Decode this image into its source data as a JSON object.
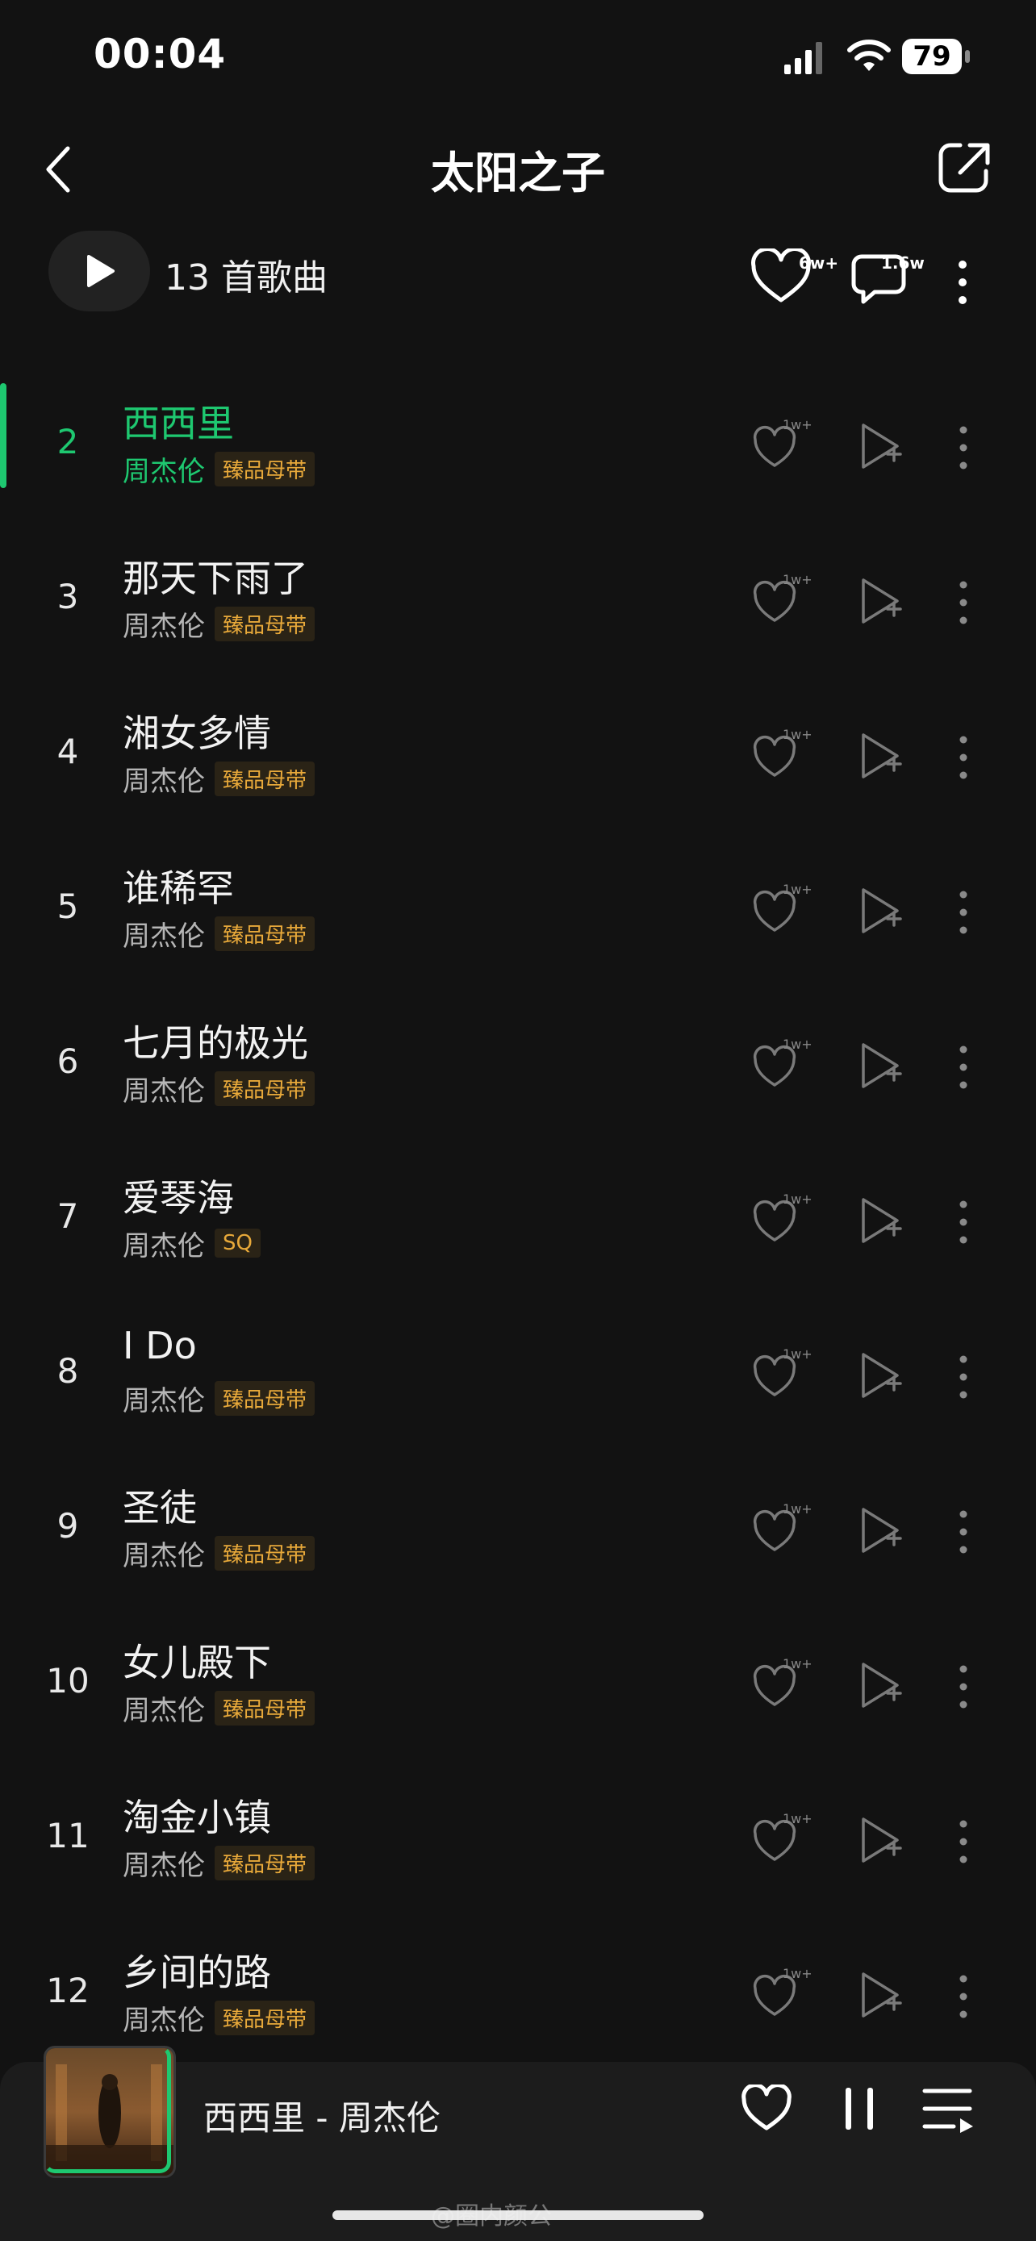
{
  "status_bar": {
    "time": "00:04",
    "battery": "79"
  },
  "header": {
    "title": "太阳之子"
  },
  "toolbar": {
    "song_count": "13 首歌曲",
    "favorite_count": "6w+",
    "comment_count": "1.6w"
  },
  "songs": [
    {
      "index": "2",
      "title": "西西里",
      "artist": "周杰伦",
      "tag": "臻品母带",
      "likes": "1w+",
      "active": true
    },
    {
      "index": "3",
      "title": "那天下雨了",
      "artist": "周杰伦",
      "tag": "臻品母带",
      "likes": "1w+"
    },
    {
      "index": "4",
      "title": "湘女多情",
      "artist": "周杰伦",
      "tag": "臻品母带",
      "likes": "1w+"
    },
    {
      "index": "5",
      "title": "谁稀罕",
      "artist": "周杰伦",
      "tag": "臻品母带",
      "likes": "1w+"
    },
    {
      "index": "6",
      "title": "七月的极光",
      "artist": "周杰伦",
      "tag": "臻品母带",
      "likes": "1w+"
    },
    {
      "index": "7",
      "title": "爱琴海",
      "artist": "周杰伦",
      "tag": "SQ",
      "likes": "1w+"
    },
    {
      "index": "8",
      "title": "I Do",
      "artist": "周杰伦",
      "tag": "臻品母带",
      "likes": "1w+"
    },
    {
      "index": "9",
      "title": "圣徒",
      "artist": "周杰伦",
      "tag": "臻品母带",
      "likes": "1w+"
    },
    {
      "index": "10",
      "title": "女儿殿下",
      "artist": "周杰伦",
      "tag": "臻品母带",
      "likes": "1w+"
    },
    {
      "index": "11",
      "title": "淘金小镇",
      "artist": "周杰伦",
      "tag": "臻品母带",
      "likes": "1w+"
    },
    {
      "index": "12",
      "title": "乡间的路",
      "artist": "周杰伦",
      "tag": "臻品母带",
      "likes": "1w+"
    }
  ],
  "player": {
    "now_playing": "西西里 - 周杰伦"
  },
  "watermark": "@圈内颜公",
  "colors": {
    "accent": "#1ec870",
    "tag": "#e8a93a",
    "background": "#121212"
  }
}
